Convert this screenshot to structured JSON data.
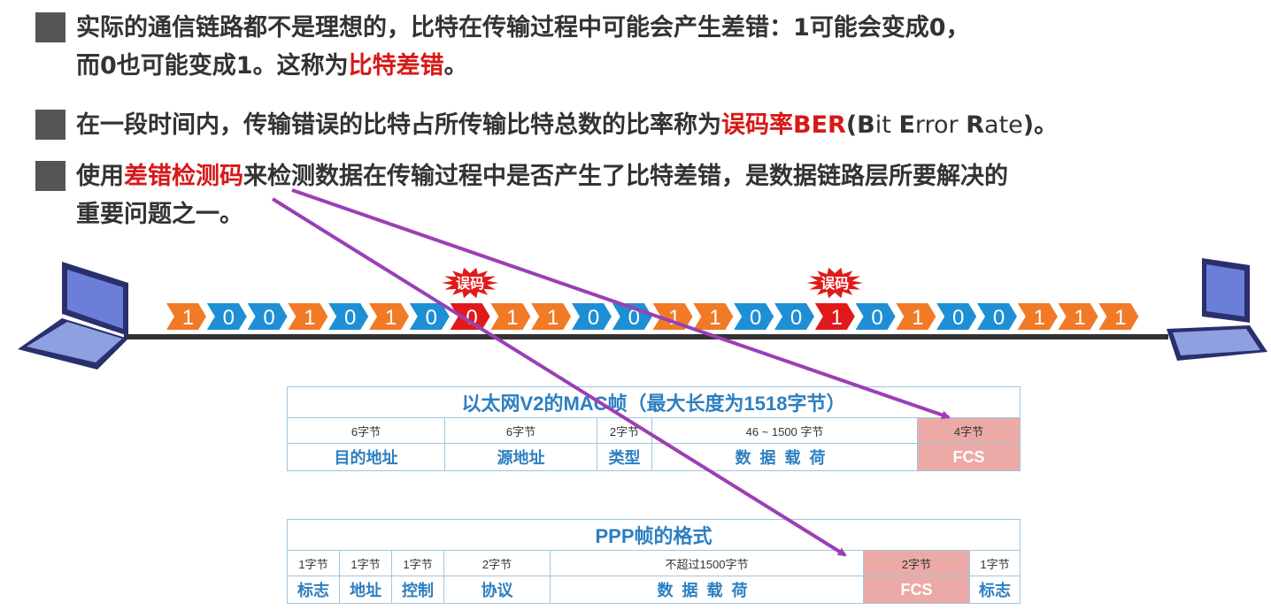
{
  "bullets": {
    "b1": {
      "line1": "实际的通信链路都不是理想的，比特在传输过程中可能会产生差错：1可能会变成0，",
      "line2_pre": "而0也可能变成1。这称为",
      "line2_hl": "比特差错",
      "line2_post": "。"
    },
    "b2": {
      "pre": "在一段时间内，传输错误的比特占所传输比特总数的比率称为",
      "hl": "误码率BER",
      "paren_open": "(",
      "B": "B",
      "it": "it ",
      "E": "E",
      "rror": "rror ",
      "R": "R",
      "ate": "ate",
      "paren_close": ")。"
    },
    "b3": {
      "pre": "使用",
      "hl": "差错检测码",
      "line1_post": "来检测数据在传输过程中是否产生了比特差错，是数据链路层所要解决的",
      "line2": "重要问题之一。"
    }
  },
  "bitstream": {
    "bits": [
      "1",
      "0",
      "0",
      "1",
      "0",
      "1",
      "0",
      "0",
      "1",
      "1",
      "0",
      "0",
      "1",
      "1",
      "0",
      "0",
      "1",
      "0",
      "1",
      "0",
      "0",
      "1",
      "1",
      "1"
    ],
    "error_indices": [
      7,
      16
    ],
    "error_label": "误码"
  },
  "mac_frame": {
    "title": "以太网V2的MAC帧（最大长度为1518字节）",
    "fields": [
      {
        "size": "6字节",
        "name": "目的地址"
      },
      {
        "size": "6字节",
        "name": "源地址"
      },
      {
        "size": "2字节",
        "name": "类型"
      },
      {
        "size": "46 ~ 1500 字节",
        "name": "数据载荷"
      },
      {
        "size": "4字节",
        "name": "FCS"
      }
    ]
  },
  "ppp_frame": {
    "title": "PPP帧的格式",
    "fields": [
      {
        "size": "1字节",
        "name": "标志"
      },
      {
        "size": "1字节",
        "name": "地址"
      },
      {
        "size": "1字节",
        "name": "控制"
      },
      {
        "size": "2字节",
        "name": "协议"
      },
      {
        "size": "不超过1500字节",
        "name": "数据载荷"
      },
      {
        "size": "2字节",
        "name": "FCS"
      },
      {
        "size": "1字节",
        "name": "标志"
      }
    ]
  },
  "colors": {
    "orange": "#f07a26",
    "blue": "#1e8fd4",
    "error_red": "#e01a1a",
    "arrow_purple": "#9b3fb5",
    "highlight_red": "#d71818",
    "table_blue": "#2d7fc1",
    "fcs_pink": "#ecaaa6"
  }
}
